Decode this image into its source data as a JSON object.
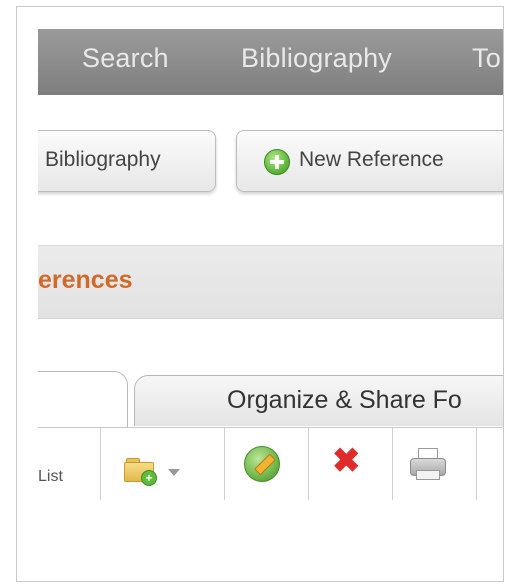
{
  "topnav": {
    "items": [
      {
        "label": "Search"
      },
      {
        "label": "Bibliography"
      },
      {
        "label": "To"
      }
    ]
  },
  "toolbar": {
    "bibliography_label": "Bibliography",
    "new_reference_label": "New Reference",
    "new_reference_icon": "plus-circle-icon"
  },
  "header": {
    "title": "erences"
  },
  "tabs": {
    "organize_label": "Organize & Share Fo"
  },
  "actions": {
    "list_label": "List",
    "icons": [
      "folder-add-icon",
      "chevron-down-icon",
      "edit-icon",
      "delete-icon",
      "print-icon"
    ],
    "delete_color": "#e02b2b"
  },
  "colors": {
    "nav_bg": "#8a8a8a",
    "accent_title": "#d06a2a",
    "add_green": "#5fbb3b"
  }
}
